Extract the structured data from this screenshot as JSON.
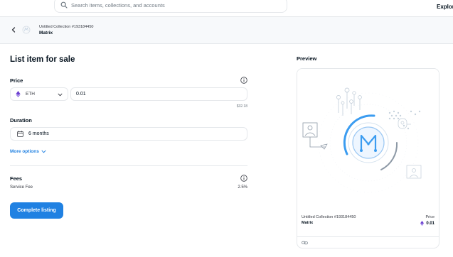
{
  "topbar": {
    "search_placeholder": "Search items, collections, and accounts",
    "explore_label": "Explor",
    "search_icon": "search-icon"
  },
  "subheader": {
    "back_icon": "chevron-left-icon",
    "collection": "Untitled Collection #193184450",
    "item_name": "Matrix"
  },
  "form": {
    "title": "List item for sale",
    "price": {
      "label": "Price",
      "currency": "ETH",
      "currency_icon": "ethereum-icon",
      "value": "0.01",
      "usd_value": "$32.18"
    },
    "duration": {
      "label": "Duration",
      "value": "6 months",
      "icon": "calendar-icon"
    },
    "more_options": "More options",
    "fees": {
      "label": "Fees",
      "service_fee_label": "Service Fee",
      "service_fee_value": "2.5%"
    },
    "submit_label": "Complete listing"
  },
  "preview": {
    "title": "Preview",
    "collection": "Untitled Collection #193184450",
    "item_name": "Matrix",
    "price_label": "Price",
    "price_value": "0.01",
    "footer_icon": "link-icon"
  },
  "colors": {
    "accent": "#2081e2",
    "eth": "#6b3fd1",
    "border": "#e5e8eb"
  }
}
